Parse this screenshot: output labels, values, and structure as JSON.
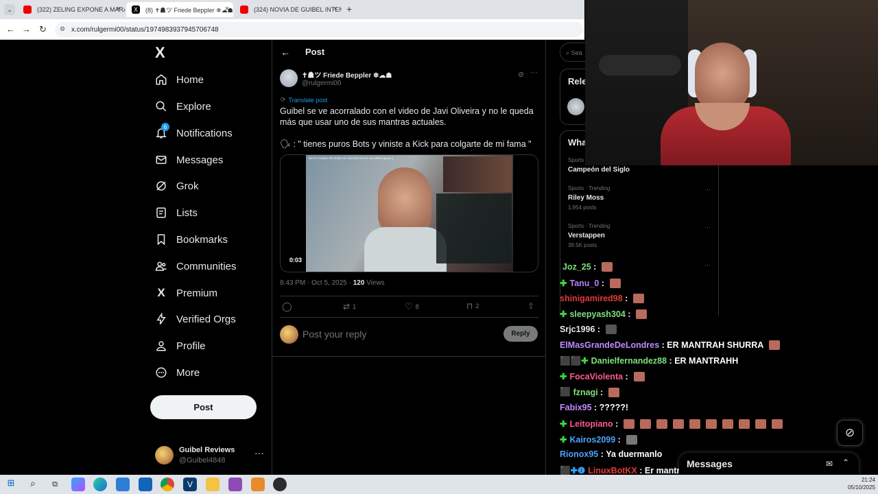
{
  "browser": {
    "tabs": [
      {
        "label": "(322) ZELING EXPONE A MARA",
        "color": "#e00"
      },
      {
        "label": "(8) ✝︎☗ツ Friede Beppler ❄☁☗",
        "color": "#000"
      },
      {
        "label": "(324) NOVIA DE GUIBEL INTEN",
        "color": "#e00"
      }
    ],
    "url": "x.com/rulgermi00/status/1974983937945706748"
  },
  "nav": {
    "logo": "X",
    "items": [
      {
        "label": "Home",
        "icon": "home-icon"
      },
      {
        "label": "Explore",
        "icon": "search-icon"
      },
      {
        "label": "Notifications",
        "icon": "bell-icon",
        "badge": "6"
      },
      {
        "label": "Messages",
        "icon": "envelope-icon"
      },
      {
        "label": "Grok",
        "icon": "grok-icon"
      },
      {
        "label": "Lists",
        "icon": "list-icon"
      },
      {
        "label": "Bookmarks",
        "icon": "bookmark-icon"
      },
      {
        "label": "Communities",
        "icon": "people-icon"
      },
      {
        "label": "Premium",
        "icon": "x-icon"
      },
      {
        "label": "Verified Orgs",
        "icon": "bolt-icon"
      },
      {
        "label": "Profile",
        "icon": "person-icon"
      },
      {
        "label": "More",
        "icon": "more-circle-icon"
      }
    ],
    "post_button": "Post",
    "account": {
      "name": "Guibel Reviews",
      "handle": "@Guibel4848"
    }
  },
  "post": {
    "header": "Post",
    "author_name": "✝︎☗ツ Friede Beppler ❄☁☗",
    "author_handle": "@rulgermi00",
    "translate": "Translate post",
    "text1": "Guibel se ve acorralado con el video de Javi Oliveira y no le queda más que usar uno de sus mantras actuales.",
    "text2": "🗣 : \" tienes puros Bots y viniste a Kick para colgarte de mi fama \"",
    "video_title": "ASÍ ES GUIBEL REVIEWS: EL SUICIDIO NO ES UN MEME (parte 1)",
    "video_time": "0:03",
    "timestamp": "8:43 PM · Oct 5, 2025 · ",
    "views_count": "120",
    "views_label": " Views",
    "counts": {
      "reposts": "1",
      "likes": "8",
      "bookmarks": "2"
    },
    "reply_placeholder": "Post your reply",
    "reply_button": "Reply"
  },
  "right": {
    "search_placeholder": "Sea",
    "relevant_title": "Rele",
    "whats_title": "Wha"
  },
  "trends": [
    {
      "context": "Sports",
      "name": "Campeón del Siglo",
      "posts": ""
    },
    {
      "context": "Sports · Trending",
      "name": "Riley Moss",
      "posts": "1,954 posts"
    },
    {
      "context": "Sports · Trending",
      "name": "Verstappen",
      "posts": "39.5K posts"
    }
  ],
  "chat": [
    {
      "user": "Joz_25",
      "text": "",
      "color": "#7fe07f",
      "badges": "",
      "emotes": 1
    },
    {
      "user": "Tanu_0",
      "text": "",
      "color": "#b780ff",
      "badges": "✚",
      "emotes": 1
    },
    {
      "user": "shinigamired98",
      "text": "",
      "color": "#e23a3a",
      "badges": "",
      "emotes": 1
    },
    {
      "user": "sleepyash304",
      "text": "",
      "color": "#7fe07f",
      "badges": "✚",
      "emotes": 1
    },
    {
      "user": "Srjc1996",
      "text": "",
      "color": "#e7e7e7",
      "badges": "",
      "emotes": 1
    },
    {
      "user": "ElMasGrandeDeLondres",
      "text": "ER MANTRAH SHURRA",
      "color": "#c08bff",
      "badges": "",
      "emotes": 1
    },
    {
      "user": "Danielfernandez88",
      "text": "ER MANTRAHH",
      "color": "#7fe07f",
      "badges": "⬛⬛✚",
      "emotes": 0
    },
    {
      "user": "FocaViolenta",
      "text": "",
      "color": "#ff5a8a",
      "badges": "✚",
      "emotes": 1
    },
    {
      "user": "fznagi",
      "text": "",
      "color": "#7fe07f",
      "badges": "⬛",
      "emotes": 1
    },
    {
      "user": "Fabix95",
      "text": "?????!",
      "color": "#c08bff",
      "badges": "",
      "emotes": 0
    },
    {
      "user": "Leitopiano",
      "text": "",
      "color": "#ff5a8a",
      "badges": "✚",
      "emotes": 10
    },
    {
      "user": "Kairos2099",
      "text": "",
      "color": "#4aa3ff",
      "badges": "✚",
      "emotes": 1
    },
    {
      "user": "Rionox95",
      "text": "Ya duermanlo",
      "color": "#4aa3ff",
      "badges": "",
      "emotes": 0
    },
    {
      "user": "LinuxBotKX",
      "text": "Er mantrah",
      "color": "#e23a3a",
      "badges": "⬛✚❶",
      "emotes": 0
    }
  ],
  "messages_drawer": {
    "label": "Messages"
  },
  "taskbar": {
    "time": "21:24",
    "date": "05/10/2025"
  }
}
